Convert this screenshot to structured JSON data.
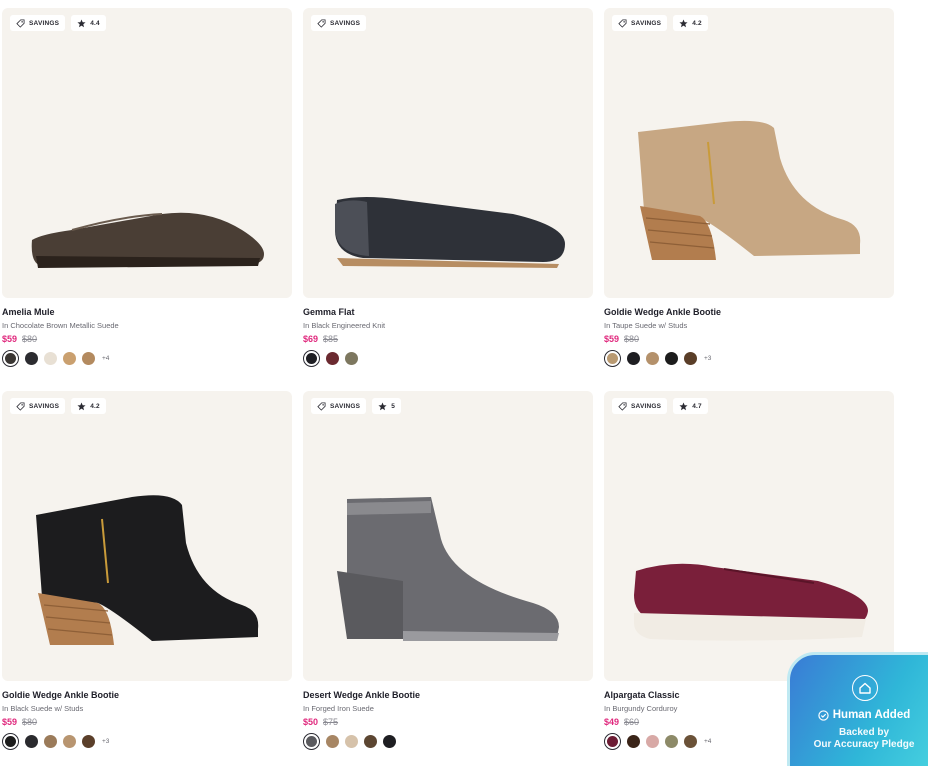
{
  "products": [
    {
      "name": "Amelia Mule",
      "variant": "In Chocolate Brown Metallic Suede",
      "sale_price": "$59",
      "original_price": "$80",
      "savings_label": "SAVINGS",
      "rating": "4.4",
      "swatches": [
        "#3a3633",
        "#2c2c30",
        "#e8e0d4",
        "#caa06f",
        "#b38a5f"
      ],
      "more": "+4"
    },
    {
      "name": "Gemma Flat",
      "variant": "In Black Engineered Knit",
      "sale_price": "$69",
      "original_price": "$85",
      "savings_label": "SAVINGS",
      "rating": "",
      "swatches": [
        "#1f1f24",
        "#6b2a30",
        "#7d775f"
      ],
      "more": ""
    },
    {
      "name": "Goldie Wedge Ankle Bootie",
      "variant": "In Taupe Suede w/ Studs",
      "sale_price": "$59",
      "original_price": "$80",
      "savings_label": "SAVINGS",
      "rating": "4.2",
      "swatches": [
        "#b99a72",
        "#1e1e22",
        "#b4916b",
        "#1c1c1c",
        "#5a3e28"
      ],
      "more": "+3"
    },
    {
      "name": "Goldie Wedge Ankle Bootie",
      "variant": "In Black Suede w/ Studs",
      "sale_price": "$59",
      "original_price": "$80",
      "savings_label": "SAVINGS",
      "rating": "4.2",
      "swatches": [
        "#1c1c1c",
        "#2a2a2e",
        "#9b7b5a",
        "#b89570",
        "#5b3f2a"
      ],
      "more": "+3"
    },
    {
      "name": "Desert Wedge Ankle Bootie",
      "variant": "In Forged Iron Suede",
      "sale_price": "$50",
      "original_price": "$75",
      "savings_label": "SAVINGS",
      "rating": "5",
      "swatches": [
        "#5a5a5e",
        "#a78664",
        "#d6c2aa",
        "#5c4632",
        "#1e1e22"
      ],
      "more": ""
    },
    {
      "name": "Alpargata Classic",
      "variant": "In Burgundy Corduroy",
      "sale_price": "$49",
      "original_price": "$60",
      "savings_label": "SAVINGS",
      "rating": "4.7",
      "swatches": [
        "#6c1c34",
        "#3a2418",
        "#d8a9a6",
        "#8d8a68",
        "#6b5238"
      ],
      "more": "+4"
    }
  ],
  "badge": {
    "title": "Human Added",
    "line1": "Backed by",
    "line2": "Our Accuracy Pledge"
  },
  "colors": {
    "sale": "#e0287d",
    "card_bg": "#f6f3ee",
    "badge_gradient_start": "#3a7bd5",
    "badge_gradient_end": "#46d0df"
  }
}
